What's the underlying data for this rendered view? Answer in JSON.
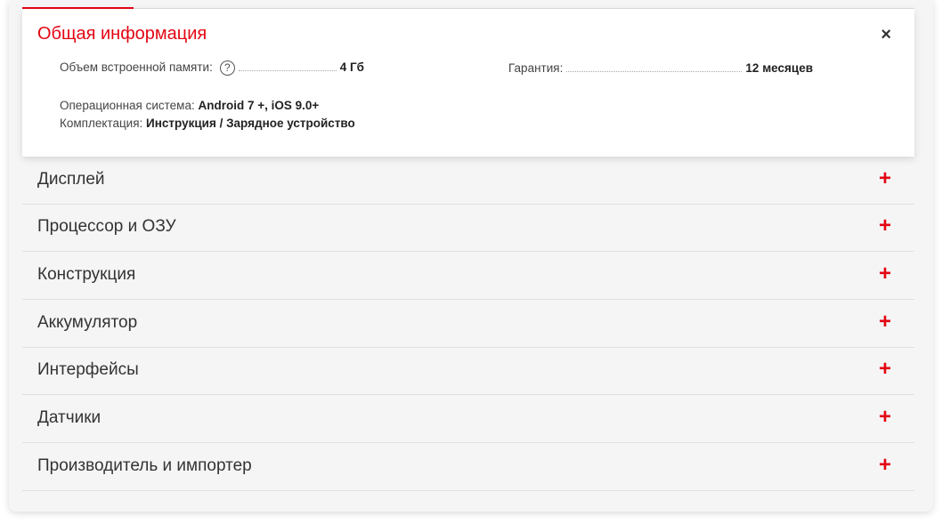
{
  "section": {
    "title": "Общая информация",
    "close": "×"
  },
  "specs": {
    "memory": {
      "label": "Объем встроенной памяти:",
      "help": "?",
      "value": "4 Гб"
    },
    "warranty": {
      "label": "Гарантия:",
      "value": "12 месяцев"
    },
    "os": {
      "label": "Операционная система:",
      "value": "Android 7 +, iOS 9.0+"
    },
    "kit": {
      "label": "Комплектация:",
      "value": "Инструкция / Зарядное устройство"
    }
  },
  "rows": [
    {
      "label": "Дисплей"
    },
    {
      "label": "Процессор и ОЗУ"
    },
    {
      "label": "Конструкция"
    },
    {
      "label": "Аккумулятор"
    },
    {
      "label": "Интерфейсы"
    },
    {
      "label": "Датчики"
    },
    {
      "label": "Производитель и импортер"
    }
  ],
  "expand_icon": "+",
  "accent": "#e30613"
}
